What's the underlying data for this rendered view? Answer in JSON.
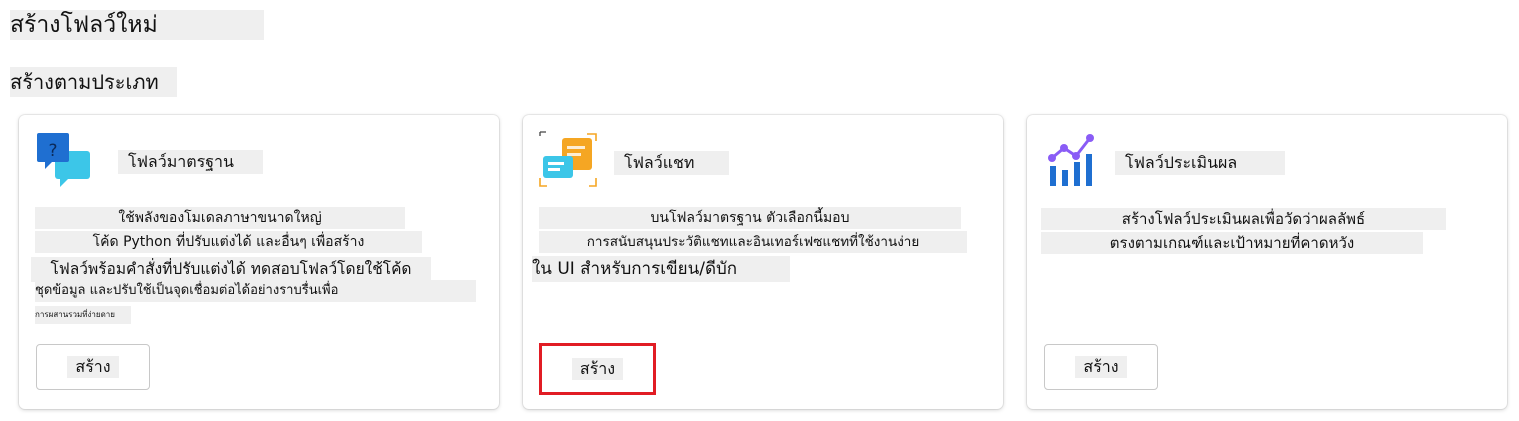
{
  "page": {
    "title": "สร้างโฟลว์ใหม่",
    "section_title": "สร้างตามประเภท"
  },
  "cards": [
    {
      "icon": "chat-question-icon",
      "title": "โฟลว์มาตรฐาน",
      "description_lines": [
        "ใช้พลังของโมเดลภาษาขนาดใหญ่",
        "โค้ด Python ที่ปรับแต่งได้ และอื่นๆ เพื่อสร้าง",
        "โฟลว์พร้อมคำสั่งที่ปรับแต่งได้ ทดสอบโฟลว์โดยใช้โค้ด",
        "ชุดข้อมูล และปรับใช้เป็นจุดเชื่อมต่อได้อย่างราบรื่นเพื่อ",
        "การผสานรวมที่ง่ายดาย"
      ],
      "button_label": "สร้าง"
    },
    {
      "icon": "chat-window-icon",
      "title": "โฟลว์แชท",
      "description_lines": [
        "บนโฟลว์มาตรฐาน ตัวเลือกนี้มอบ",
        "การสนับสนุนประวัติแชทและอินเทอร์เฟซแชทที่ใช้งานง่าย",
        "ใน UI สำหรับการเขียน/ดีบัก"
      ],
      "button_label": "สร้าง"
    },
    {
      "icon": "evaluation-chart-icon",
      "title": "โฟลว์ประเมินผล",
      "description_lines": [
        "สร้างโฟลว์ประเมินผลเพื่อวัดว่าผลลัพธ์",
        "ตรงตามเกณฑ์และเป้าหมายที่คาดหวัง"
      ],
      "button_label": "สร้าง"
    }
  ],
  "colors": {
    "highlight_border": "#e11c24",
    "text_highlight_bg": "#efefef",
    "icon_blue": "#1a73e8",
    "icon_cyan": "#3cc6e8",
    "icon_orange": "#f5a623",
    "icon_purple": "#8a5cf6"
  }
}
